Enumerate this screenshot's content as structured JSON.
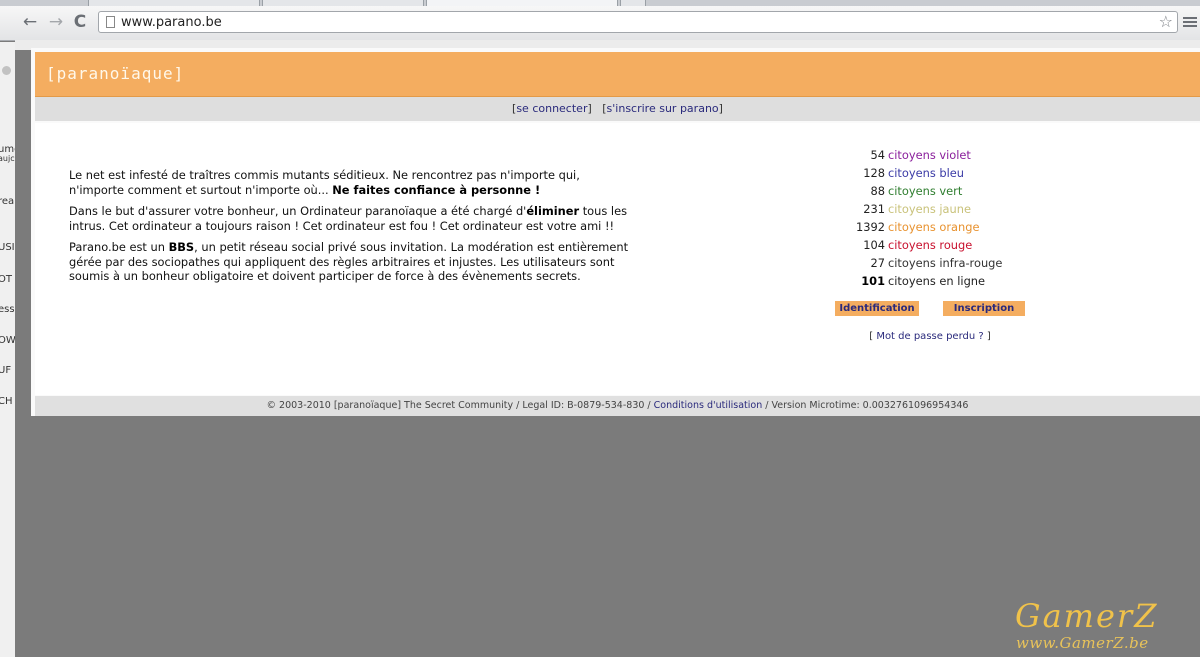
{
  "browser": {
    "url": "www.parano.be",
    "nav": {
      "back": "←",
      "forward": "→",
      "reload": "C"
    },
    "star": "☆"
  },
  "left_strip": [
    "ume",
    "aujc",
    "rea",
    "USIO",
    "OT",
    "ess",
    "OW",
    "UF",
    "CH"
  ],
  "site": {
    "logo": "[paranoïaque]",
    "top_links": {
      "login": "se connecter",
      "signup": "s'inscrire sur parano"
    },
    "intro": {
      "p1_text": "Le net est infesté de traîtres commis mutants séditieux. Ne rencontrez pas n'importe qui, n'importe comment et surtout n'importe où... ",
      "p1_bold": "Ne faites confiance à personne !",
      "p2_text_a": "Dans le but d'assurer votre bonheur, un Ordinateur paranoïaque a été chargé d'",
      "p2_bold": "éliminer",
      "p2_text_b": " tous les intrus. Cet ordinateur a toujours raison ! Cet ordinateur est fou ! Cet ordinateur est votre ami !!",
      "p3_text_a": "Parano.be est un ",
      "p3_bold": "BBS",
      "p3_text_b": ", un petit réseau social privé sous invitation. La modération est entièrement gérée par des sociopathes qui appliquent des règles arbitraires et injustes. Les utilisateurs sont soumis à un bonheur obligatoire et doivent participer de force à des évènements secrets."
    },
    "stats": [
      {
        "count": "54",
        "label": "citoyens violet",
        "color": "#8a1e9c"
      },
      {
        "count": "128",
        "label": "citoyens bleu",
        "color": "#3a3aa6"
      },
      {
        "count": "88",
        "label": "citoyens vert",
        "color": "#2e7d2e"
      },
      {
        "count": "231",
        "label": "citoyens jaune",
        "color": "#c9c27a"
      },
      {
        "count": "1392",
        "label": "citoyens orange",
        "color": "#e8922f"
      },
      {
        "count": "104",
        "label": "citoyens rouge",
        "color": "#c8102e"
      },
      {
        "count": "27",
        "label": "citoyens infra-rouge",
        "color": "#333333"
      },
      {
        "count": "101",
        "label": "citoyens en ligne",
        "color": "#222222"
      }
    ],
    "buttons": {
      "identification": "Identification",
      "inscription": "Inscription"
    },
    "lost_password": "Mot de passe perdu ?",
    "footer": {
      "text_a": "© 2003-2010 [paranoïaque] The Secret Community / Legal ID: B-0879-534-830 / ",
      "link": "Conditions d'utilisation",
      "text_b": " / Version Microtime: 0.0032761096954346"
    }
  },
  "watermark": {
    "title": "GamerZ",
    "subtitle": "www.GamerZ.be"
  }
}
